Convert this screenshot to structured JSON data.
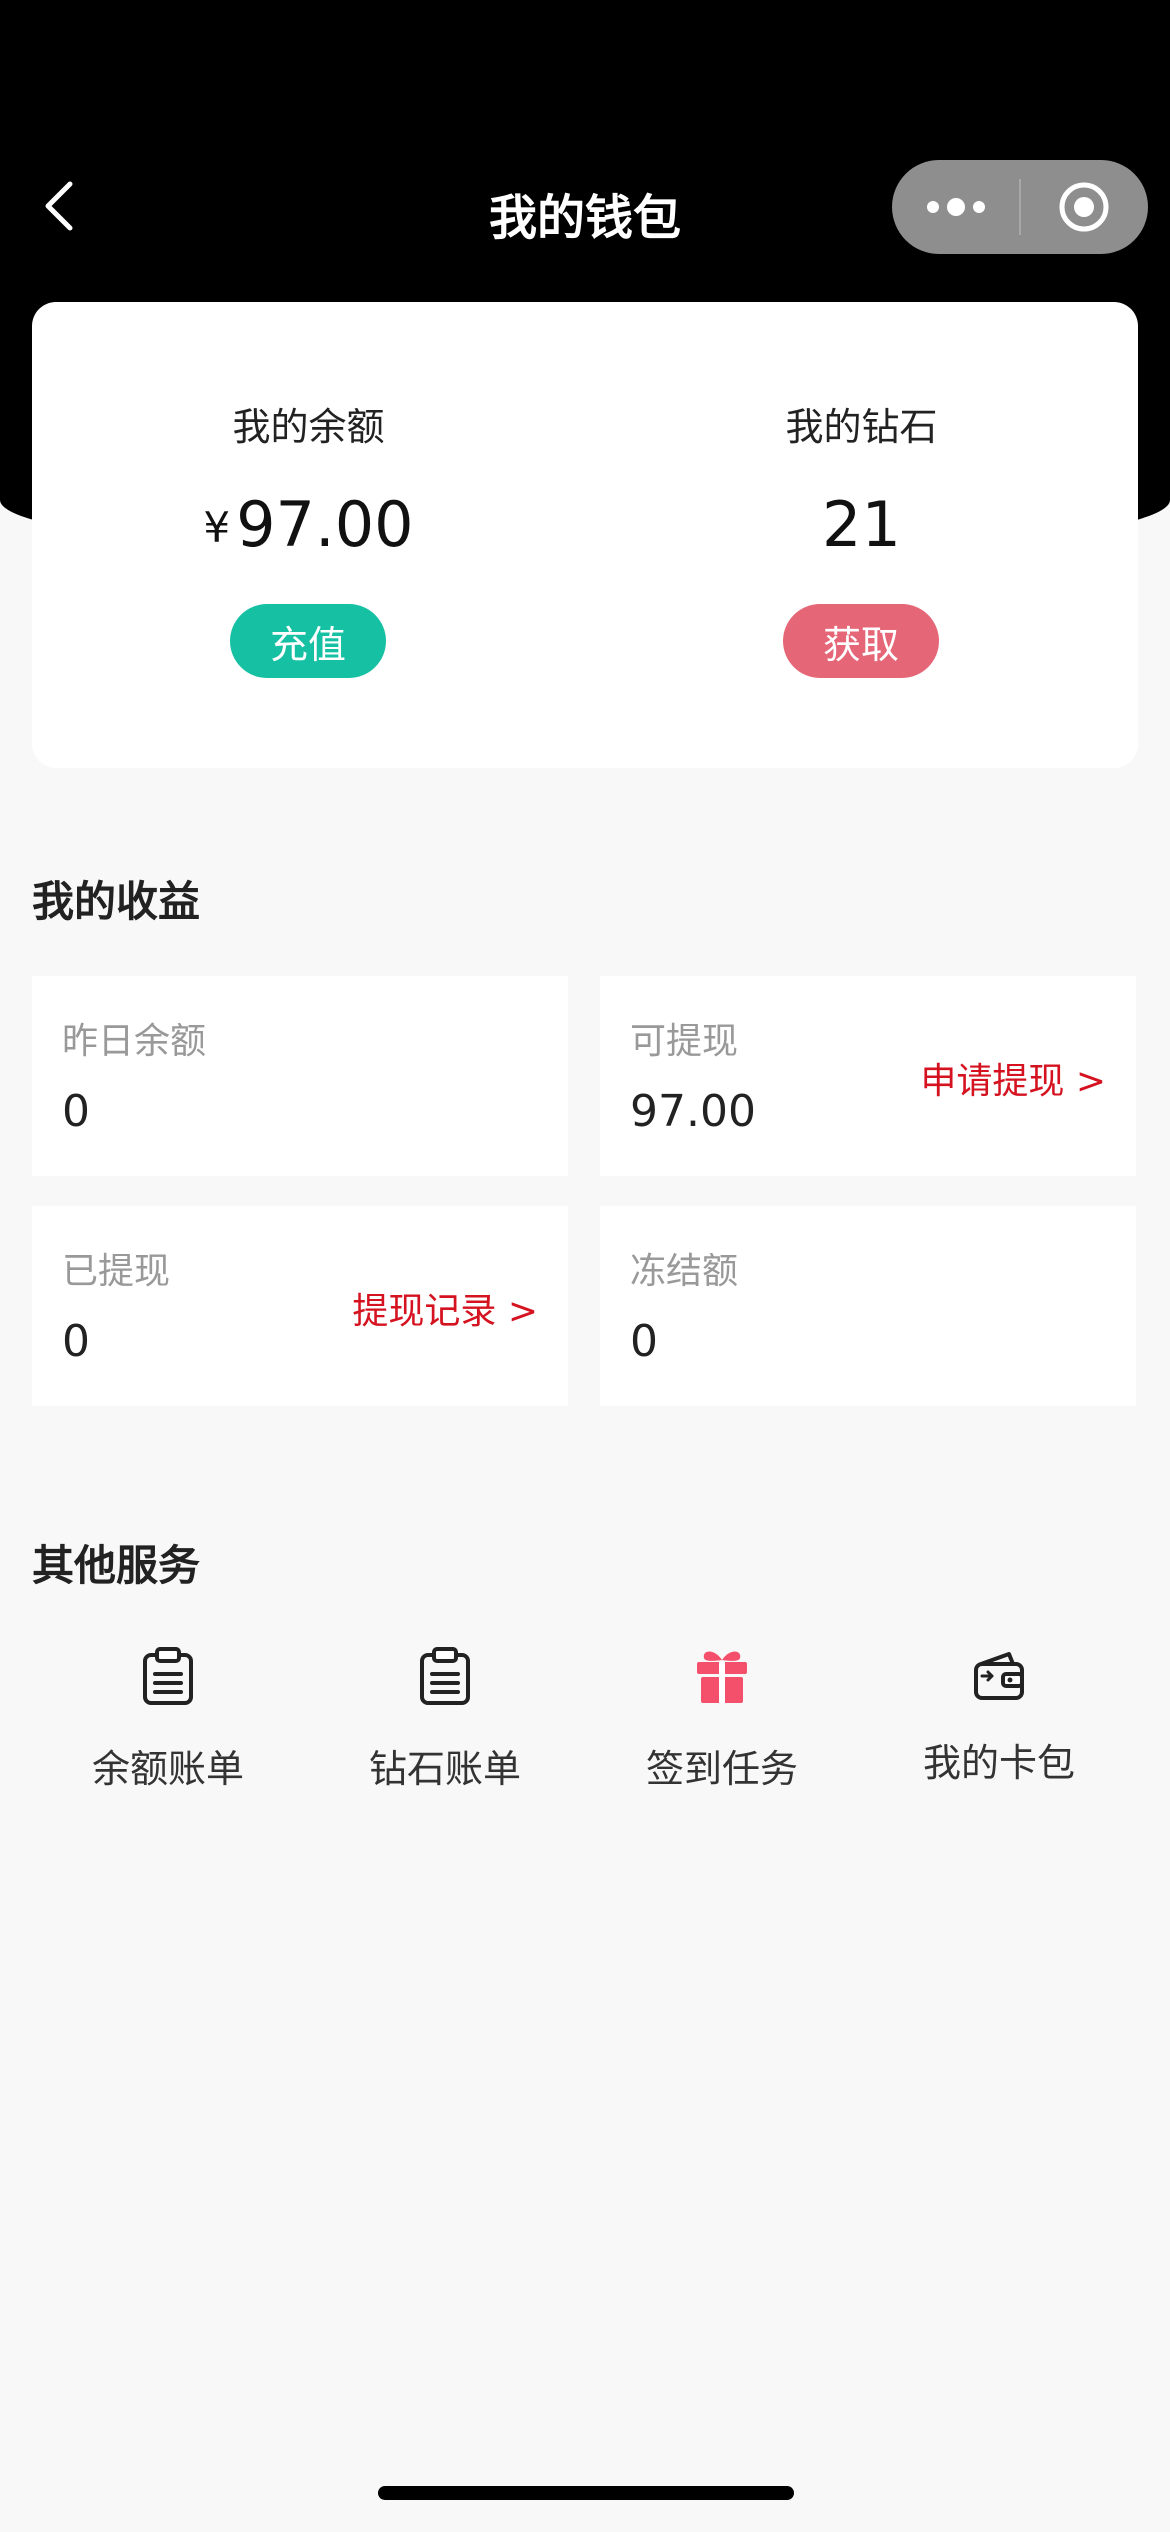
{
  "navbar": {
    "title": "我的钱包"
  },
  "wallet": {
    "balance": {
      "label": "我的余额",
      "currency": "¥",
      "value": "97.00",
      "button_label": "充值",
      "button_color": "#16c0a3"
    },
    "diamonds": {
      "label": "我的钻石",
      "value": "21",
      "button_label": "获取",
      "button_color": "#e56777"
    }
  },
  "earnings": {
    "title": "我的收益",
    "cards": [
      {
        "label": "昨日余额",
        "value": "0"
      },
      {
        "label": "可提现",
        "value": "97.00",
        "link_label": "申请提现 >"
      },
      {
        "label": "已提现",
        "value": "0",
        "link_label": "提现记录 >"
      },
      {
        "label": "冻结额",
        "value": "0"
      }
    ]
  },
  "services": {
    "title": "其他服务",
    "items": [
      {
        "label": "余额账单",
        "icon": "clipboard-icon"
      },
      {
        "label": "钻石账单",
        "icon": "clipboard-icon"
      },
      {
        "label": "签到任务",
        "icon": "gift-icon"
      },
      {
        "label": "我的卡包",
        "icon": "wallet-icon"
      }
    ]
  },
  "colors": {
    "link_red": "#d5121f",
    "gift_pink": "#f5506b"
  }
}
